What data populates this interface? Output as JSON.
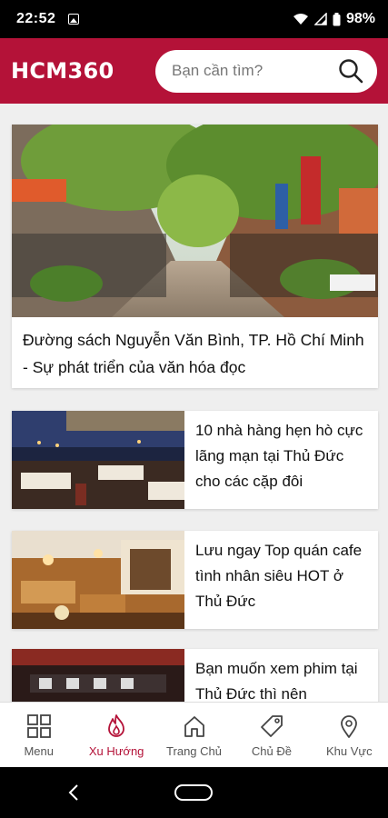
{
  "status_bar": {
    "time": "22:52",
    "battery": "98%"
  },
  "app_bar": {
    "logo": "HCM360",
    "search_placeholder": "Bạn cần tìm?"
  },
  "articles": [
    {
      "title": "Đường sách Nguyễn Văn Bình, TP. Hồ Chí Minh - Sự phát triển của văn hóa đọc"
    },
    {
      "title": "10 nhà hàng hẹn hò cực lãng mạn tại Thủ Đức cho các cặp đôi"
    },
    {
      "title": "Lưu ngay Top quán cafe tình nhân siêu HOT ở Thủ Đức"
    },
    {
      "title": "Bạn muốn xem phim tại Thủ Đức thì nên"
    }
  ],
  "bottom_nav": [
    {
      "label": "Menu",
      "icon": "grid-icon"
    },
    {
      "label": "Xu Hướng",
      "icon": "flame-icon",
      "active": true
    },
    {
      "label": "Trang Chủ",
      "icon": "home-icon"
    },
    {
      "label": "Chủ Đề",
      "icon": "tag-icon"
    },
    {
      "label": "Khu Vực",
      "icon": "location-pin-icon"
    }
  ],
  "colors": {
    "brand": "#b41238",
    "active_nav": "#b41238"
  }
}
